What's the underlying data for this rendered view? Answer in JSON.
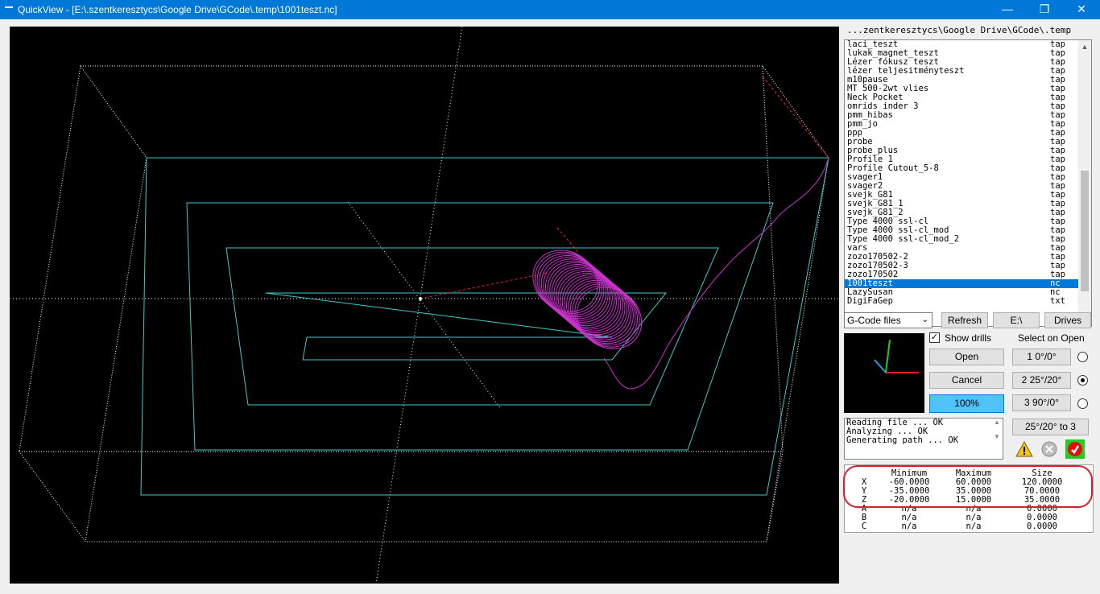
{
  "window": {
    "title": "QuickView - [E:\\.szentkeresztycs\\Google Drive\\GCode\\.temp\\1001teszt.nc]",
    "minimize": "—",
    "maximize": "❐",
    "close": "✕"
  },
  "browser": {
    "path": "...zentkeresztycs\\Google Drive\\GCode\\.temp",
    "files": [
      {
        "name": "laci_teszt",
        "ext": "tap"
      },
      {
        "name": "lukak_magnet_teszt",
        "ext": "tap"
      },
      {
        "name": "Lézer fókusz teszt",
        "ext": "tap"
      },
      {
        "name": "lézer teljesitményteszt",
        "ext": "tap"
      },
      {
        "name": "m10pause",
        "ext": "tap"
      },
      {
        "name": "MT 500-2wt vlies",
        "ext": "tap"
      },
      {
        "name": "Neck Pocket",
        "ext": "tap"
      },
      {
        "name": "omrids inder 3",
        "ext": "tap"
      },
      {
        "name": "pmm_hibas",
        "ext": "tap"
      },
      {
        "name": "pmm_jo",
        "ext": "tap"
      },
      {
        "name": "ppp",
        "ext": "tap"
      },
      {
        "name": "probe",
        "ext": "tap"
      },
      {
        "name": "probe_plus",
        "ext": "tap"
      },
      {
        "name": "Profile 1",
        "ext": "tap"
      },
      {
        "name": "Profile Cutout_5-8",
        "ext": "tap"
      },
      {
        "name": "svager1",
        "ext": "tap"
      },
      {
        "name": "svager2",
        "ext": "tap"
      },
      {
        "name": "svejk_G81",
        "ext": "tap"
      },
      {
        "name": "svejk_G81_1",
        "ext": "tap"
      },
      {
        "name": "svejk_G81_2",
        "ext": "tap"
      },
      {
        "name": "Type 4000 ssl-cl",
        "ext": "tap"
      },
      {
        "name": "Type 4000 ssl-cl_mod",
        "ext": "tap"
      },
      {
        "name": "Type 4000 ssl-cl_mod_2",
        "ext": "tap"
      },
      {
        "name": "vars",
        "ext": "tap"
      },
      {
        "name": "zozo170502-2",
        "ext": "tap"
      },
      {
        "name": "zozo170502-3",
        "ext": "tap"
      },
      {
        "name": "zozo170502",
        "ext": "tap"
      },
      {
        "name": "1001teszt",
        "ext": "nc",
        "selected": true
      },
      {
        "name": "LazySusan",
        "ext": "nc"
      },
      {
        "name": "DigiFaGep",
        "ext": "txt"
      }
    ]
  },
  "controls": {
    "filter": "G-Code files",
    "refresh": "Refresh",
    "drive_e": "E:\\",
    "drives": "Drives",
    "show_drills": "Show drills",
    "show_drills_checked": true,
    "select_on_open": "Select on Open",
    "open": "Open",
    "cancel": "Cancel",
    "zoom": "100%",
    "view1": "1 0°/0°",
    "view2": "2 25°/20°",
    "view3": "3 90°/0°",
    "view_to3": "25°/20° to 3",
    "selected_view": 2
  },
  "log": [
    "Reading file ... OK",
    "Analyzing ... OK",
    "Generating path ... OK"
  ],
  "stats": {
    "headers": [
      "Minimum",
      "Maximum",
      "Size"
    ],
    "rows": [
      {
        "axis": "X",
        "min": "-60.0000",
        "max": "60.0000",
        "size": "120.0000"
      },
      {
        "axis": "Y",
        "min": "-35.0000",
        "max": "35.0000",
        "size": "70.0000"
      },
      {
        "axis": "Z",
        "min": "-20.0000",
        "max": "15.0000",
        "size": "35.0000"
      },
      {
        "axis": "A",
        "min": "n/a",
        "max": "n/a",
        "size": "0.0000"
      },
      {
        "axis": "B",
        "min": "n/a",
        "max": "n/a",
        "size": "0.0000"
      },
      {
        "axis": "C",
        "min": "n/a",
        "max": "n/a",
        "size": "0.0000"
      }
    ]
  },
  "icons": {
    "warning": "warning-icon",
    "stop": "stop-icon",
    "exit": "exit-icon"
  },
  "colors": {
    "titlebar": "#0078d7",
    "path": "#cc33cc",
    "outline": "#40c8c8",
    "selection": "#0078d7",
    "annotation": "#d81e2a"
  }
}
